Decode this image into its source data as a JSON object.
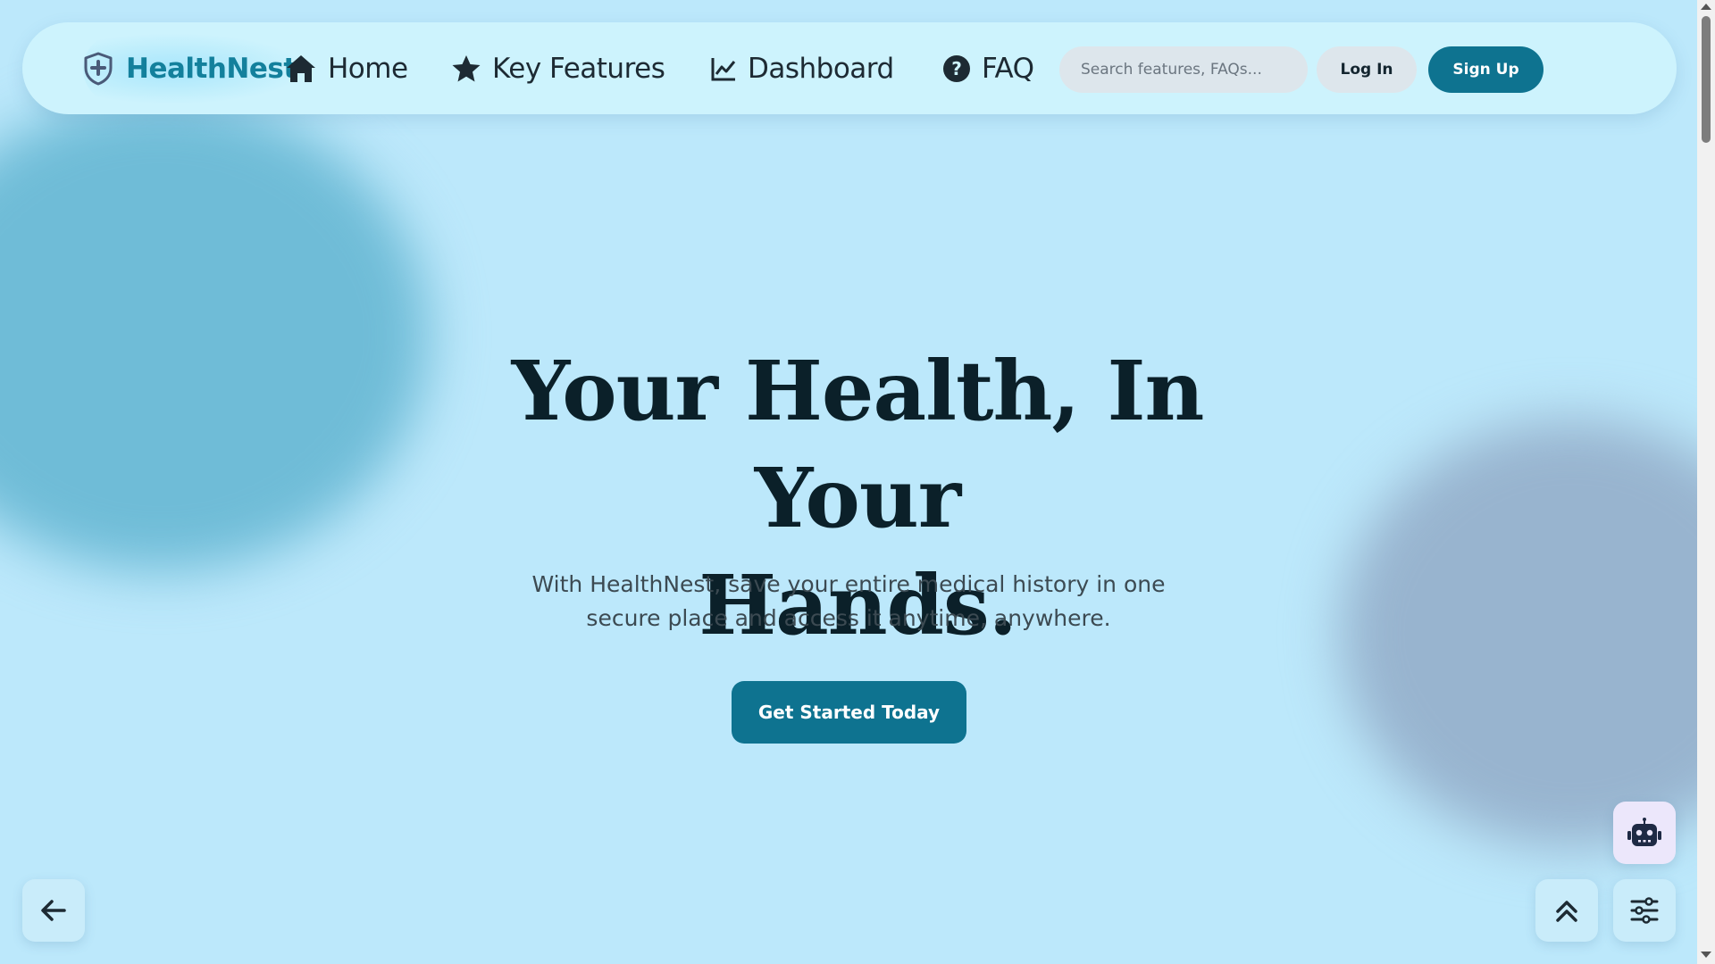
{
  "nav": {
    "brand": "HealthNest",
    "brand_icon": "shield-plus-icon",
    "links": [
      {
        "label": "Home",
        "icon": "home-icon"
      },
      {
        "label": "Key Features",
        "icon": "star-icon"
      },
      {
        "label": "Dashboard",
        "icon": "chart-line-icon"
      },
      {
        "label": "FAQ",
        "icon": "question-circle-icon"
      }
    ],
    "search_placeholder": "Search features, FAQs...",
    "login_label": "Log In",
    "signup_label": "Sign Up"
  },
  "hero": {
    "title_line1": "Your Health, In Your",
    "title_line2": "Hands.",
    "subtitle_line1": "With HealthNest, save your entire medical history in one",
    "subtitle_line2": "secure place and access it anytime, anywhere.",
    "cta_label": "Get Started Today"
  },
  "floating": {
    "back_icon": "arrow-left-icon",
    "top_icon": "double-chevron-up-icon",
    "settings_icon": "sliders-icon",
    "bot_icon": "robot-icon"
  },
  "colors": {
    "background": "#bce8fb",
    "navbar": "#cdf3fd",
    "brand": "#13809c",
    "primary_button": "#0e7390",
    "heading": "#0b2029"
  }
}
